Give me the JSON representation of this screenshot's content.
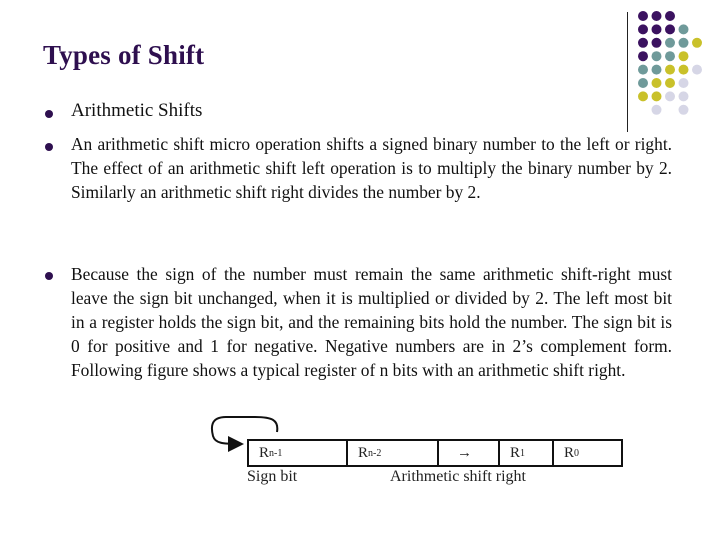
{
  "slide": {
    "title": "Types of Shift",
    "bullets": [
      {
        "text": "Arithmetic Shifts"
      },
      {
        "text": "An arithmetic shift micro operation shifts a signed binary number to the left or right. The effect of an arithmetic shift left operation is to multiply the binary number by 2. Similarly an arithmetic shift right divides the number by 2."
      },
      {
        "text": "Because the sign of the number must remain the same arithmetic shift-right must leave the sign bit unchanged, when it is multiplied or divided by 2. The left most bit in a register holds the sign bit, and the remaining bits hold the number. The sign bit is 0 for positive and 1 for negative. Negative numbers are in 2’s complement form. Following figure shows a typical register of n bits with an arithmetic shift right."
      }
    ]
  },
  "figure": {
    "cells": [
      {
        "base": "R",
        "sub": "n-1"
      },
      {
        "base": "R",
        "sub": "n-2"
      },
      {
        "base": "→",
        "sub": ""
      },
      {
        "base": "R",
        "sub": "1"
      },
      {
        "base": "R",
        "sub": "0"
      }
    ],
    "sign_label": "Sign bit",
    "shift_label": "Arithmetic shift right"
  },
  "theme": {
    "title_color": "#2e0f4f",
    "bullet_color": "#2e0f4f",
    "decor_colors": {
      "purple": "#3b1260",
      "teal": "#6f9a9a",
      "yellow": "#c9c12a",
      "lavender": "#d6d6e6"
    },
    "decor_grid": [
      [
        "purple",
        "purple",
        "purple",
        "",
        ""
      ],
      [
        "purple",
        "purple",
        "purple",
        "teal",
        ""
      ],
      [
        "purple",
        "purple",
        "teal",
        "teal",
        "yellow"
      ],
      [
        "purple",
        "teal",
        "teal",
        "yellow",
        ""
      ],
      [
        "teal",
        "teal",
        "yellow",
        "yellow",
        "lavender"
      ],
      [
        "teal",
        "yellow",
        "yellow",
        "lavender",
        ""
      ],
      [
        "yellow",
        "yellow",
        "lavender",
        "lavender",
        ""
      ],
      [
        "",
        "lavender",
        "",
        "lavender",
        ""
      ]
    ]
  }
}
